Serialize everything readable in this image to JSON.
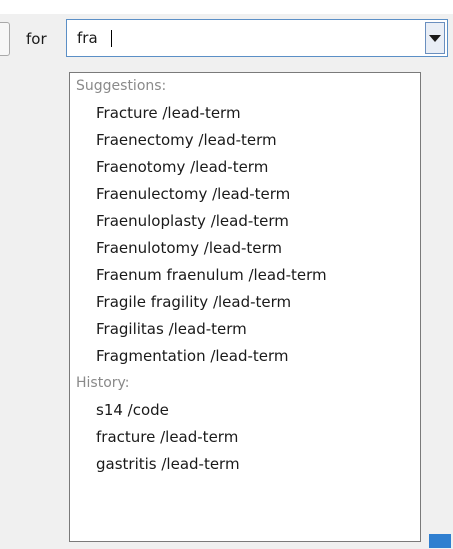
{
  "search": {
    "for_label": "for",
    "query": "fra"
  },
  "popup": {
    "suggestions_header": "Suggestions:",
    "suggestions": [
      "Fracture /lead-term",
      "Fraenectomy /lead-term",
      "Fraenotomy /lead-term",
      "Fraenulectomy /lead-term",
      "Fraenuloplasty /lead-term",
      "Fraenulotomy /lead-term",
      "Fraenum fraenulum /lead-term",
      "Fragile fragility /lead-term",
      "Fragilitas /lead-term",
      "Fragmentation /lead-term"
    ],
    "history_header": "History:",
    "history": [
      "s14 /code",
      "fracture /lead-term",
      "gastritis /lead-term"
    ]
  },
  "icons": {
    "dropdown": "chevron-down-icon"
  },
  "colors": {
    "combo_border": "#5b8fc6",
    "header_text": "#8a8a8a",
    "accent": "#2f7fd0"
  }
}
